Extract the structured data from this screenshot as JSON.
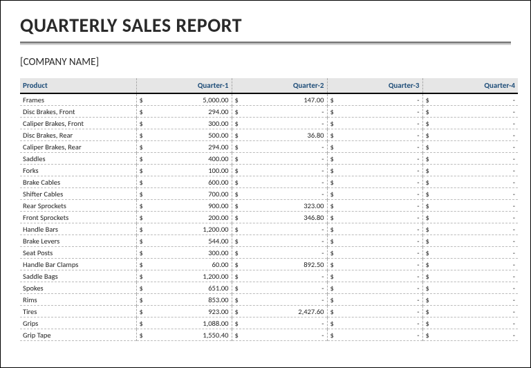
{
  "title": "QUARTERLY SALES REPORT",
  "company": "[COMPANY NAME]",
  "currency": "$",
  "dash": "-",
  "headers": {
    "product": "Product",
    "q1": "Quarter-1",
    "q2": "Quarter-2",
    "q3": "Quarter-3",
    "q4": "Quarter-4"
  },
  "rows": [
    {
      "product": "Frames",
      "q1": "5,000.00",
      "q2": "147.00",
      "q3": null,
      "q4": null
    },
    {
      "product": "Disc Brakes, Front",
      "q1": "294.00",
      "q2": null,
      "q3": null,
      "q4": null
    },
    {
      "product": "Caliper Brakes, Front",
      "q1": "300.00",
      "q2": null,
      "q3": null,
      "q4": null
    },
    {
      "product": "Disc Brakes, Rear",
      "q1": "500.00",
      "q2": "36.80",
      "q3": null,
      "q4": null
    },
    {
      "product": "Caliper Brakes, Rear",
      "q1": "294.00",
      "q2": null,
      "q3": null,
      "q4": null
    },
    {
      "product": "Saddles",
      "q1": "400.00",
      "q2": null,
      "q3": null,
      "q4": null
    },
    {
      "product": "Forks",
      "q1": "100.00",
      "q2": null,
      "q3": null,
      "q4": null
    },
    {
      "product": "Brake Cables",
      "q1": "600.00",
      "q2": null,
      "q3": null,
      "q4": null
    },
    {
      "product": "Shifter Cables",
      "q1": "700.00",
      "q2": null,
      "q3": null,
      "q4": null
    },
    {
      "product": "Rear Sprockets",
      "q1": "900.00",
      "q2": "323.00",
      "q3": null,
      "q4": null
    },
    {
      "product": "Front Sprockets",
      "q1": "200.00",
      "q2": "346.80",
      "q3": null,
      "q4": null
    },
    {
      "product": "Handle Bars",
      "q1": "1,200.00",
      "q2": null,
      "q3": null,
      "q4": null
    },
    {
      "product": "Brake Levers",
      "q1": "544.00",
      "q2": null,
      "q3": null,
      "q4": null
    },
    {
      "product": "Seat Posts",
      "q1": "300.00",
      "q2": null,
      "q3": null,
      "q4": null
    },
    {
      "product": "Handle Bar Clamps",
      "q1": "60.00",
      "q2": "892.50",
      "q3": null,
      "q4": null
    },
    {
      "product": "Saddle Bags",
      "q1": "1,200.00",
      "q2": null,
      "q3": null,
      "q4": null
    },
    {
      "product": "Spokes",
      "q1": "651.00",
      "q2": null,
      "q3": null,
      "q4": null
    },
    {
      "product": "Rims",
      "q1": "853.00",
      "q2": null,
      "q3": null,
      "q4": null
    },
    {
      "product": "Tires",
      "q1": "923.00",
      "q2": "2,427.60",
      "q3": null,
      "q4": null
    },
    {
      "product": "Grips",
      "q1": "1,088.00",
      "q2": null,
      "q3": null,
      "q4": null
    },
    {
      "product": "Grip Tape",
      "q1": "1,550.40",
      "q2": null,
      "q3": null,
      "q4": null
    }
  ]
}
